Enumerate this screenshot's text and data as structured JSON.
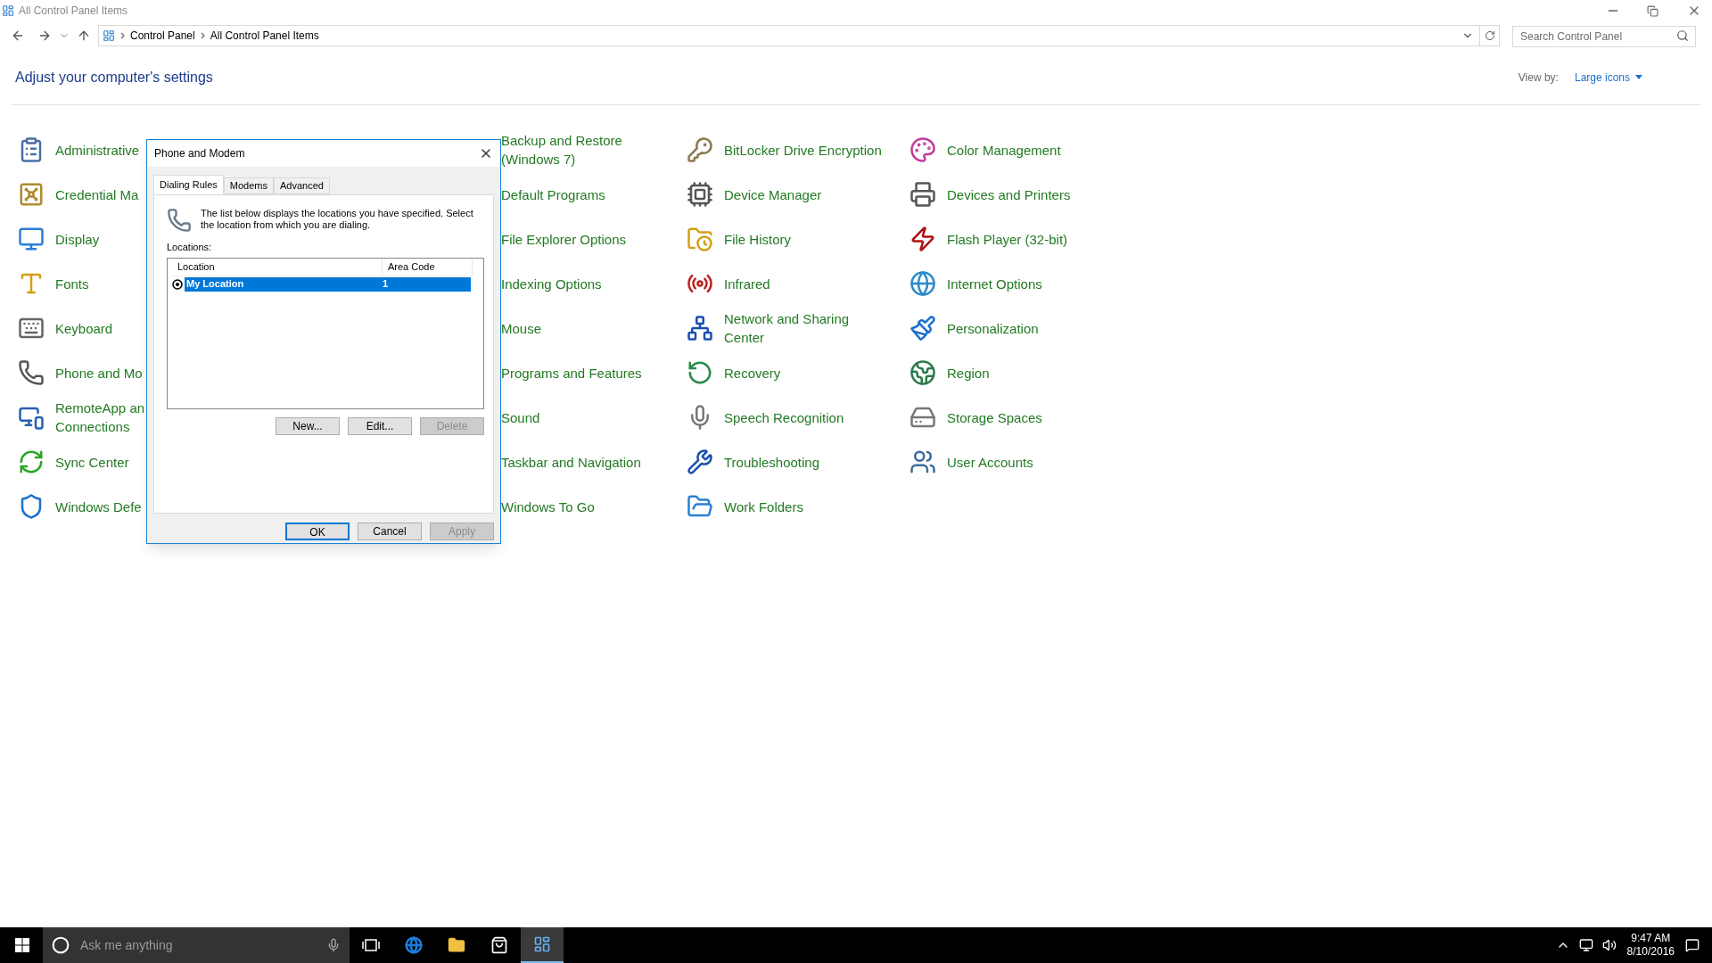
{
  "window": {
    "title": "All Control Panel Items"
  },
  "address_bar": {
    "path": [
      "Control Panel",
      "All Control Panel Items"
    ]
  },
  "search": {
    "placeholder": "Search Control Panel"
  },
  "heading": "Adjust your computer's settings",
  "view_by": {
    "label": "View by:",
    "value": "Large icons"
  },
  "columns": [
    {
      "items": [
        {
          "label": "Administrative"
        },
        {
          "label": "Credential Ma"
        },
        {
          "label": "Display"
        },
        {
          "label": "Fonts"
        },
        {
          "label": "Keyboard"
        },
        {
          "label": "Phone and Mo"
        },
        {
          "label": "RemoteApp an\nConnections"
        },
        {
          "label": "Sync Center"
        },
        {
          "label": "Windows Defe"
        }
      ]
    },
    {
      "items": [
        {
          "label": "Backup and Restore\n(Windows 7)"
        },
        {
          "label": "Default Programs"
        },
        {
          "label": "File Explorer Options"
        },
        {
          "label": "Indexing Options"
        },
        {
          "label": "Mouse"
        },
        {
          "label": "Programs and Features"
        },
        {
          "label": "Sound"
        },
        {
          "label": "Taskbar and Navigation"
        },
        {
          "label": "Windows To Go"
        }
      ]
    },
    {
      "items": [
        {
          "label": "BitLocker Drive Encryption"
        },
        {
          "label": "Device Manager"
        },
        {
          "label": "File History"
        },
        {
          "label": "Infrared"
        },
        {
          "label": "Network and Sharing\nCenter"
        },
        {
          "label": "Recovery"
        },
        {
          "label": "Speech Recognition"
        },
        {
          "label": "Troubleshooting"
        },
        {
          "label": "Work Folders"
        }
      ]
    },
    {
      "items": [
        {
          "label": "Color Management"
        },
        {
          "label": "Devices and Printers"
        },
        {
          "label": "Flash Player (32-bit)"
        },
        {
          "label": "Internet Options"
        },
        {
          "label": "Personalization"
        },
        {
          "label": "Region"
        },
        {
          "label": "Storage Spaces"
        },
        {
          "label": "User Accounts"
        }
      ]
    }
  ],
  "dialog": {
    "title": "Phone and Modem",
    "tabs": [
      {
        "label": "Dialing Rules",
        "selected": true
      },
      {
        "label": "Modems",
        "selected": false
      },
      {
        "label": "Advanced",
        "selected": false
      }
    ],
    "description": "The list below displays the locations you have specified. Select the location from which you are dialing.",
    "locations_label": "Locations:",
    "table": {
      "columns": [
        "Location",
        "Area Code"
      ],
      "rows": [
        {
          "location": "My Location",
          "area_code": "1",
          "selected": true
        }
      ]
    },
    "list_buttons": [
      {
        "label": "New...",
        "disabled": false
      },
      {
        "label": "Edit...",
        "disabled": false
      },
      {
        "label": "Delete",
        "disabled": true
      }
    ],
    "footer_buttons": [
      {
        "label": "OK",
        "disabled": false,
        "default": true
      },
      {
        "label": "Cancel",
        "disabled": false,
        "default": false
      },
      {
        "label": "Apply",
        "disabled": true,
        "default": false
      }
    ]
  },
  "taskbar": {
    "search_placeholder": "Ask me anything",
    "time": "9:47 AM",
    "date": "8/10/2016"
  }
}
